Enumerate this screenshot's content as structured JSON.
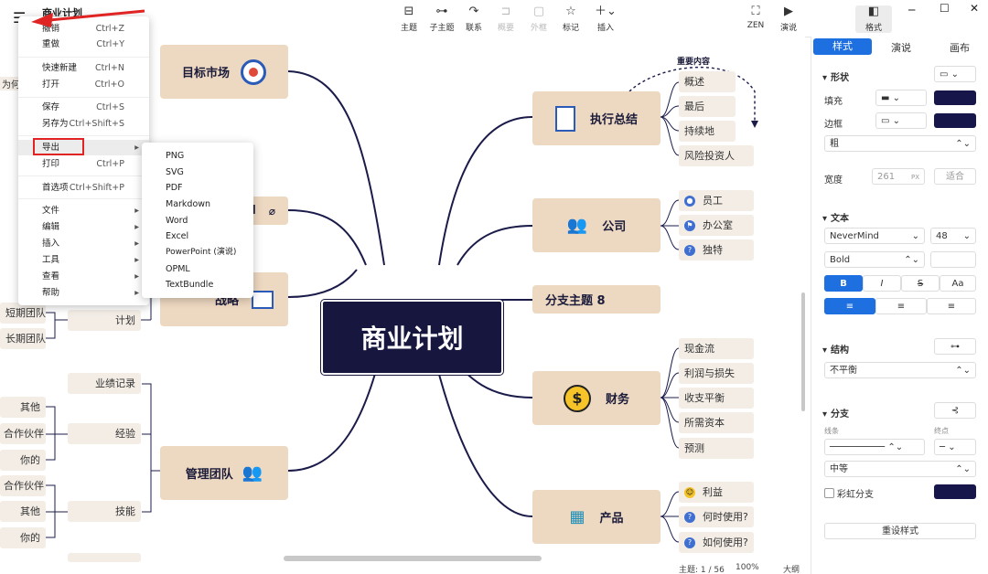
{
  "window": {
    "title": "商业计划"
  },
  "toolbar": {
    "items": [
      {
        "label": "主题",
        "icon": "topic-icon"
      },
      {
        "label": "子主题",
        "icon": "subtopic-icon"
      },
      {
        "label": "联系",
        "icon": "relationship-icon"
      },
      {
        "label": "概要",
        "icon": "summary-icon"
      },
      {
        "label": "外框",
        "icon": "boundary-icon"
      },
      {
        "label": "标记",
        "icon": "marker-icon"
      },
      {
        "label": "插入",
        "icon": "insert-icon"
      },
      {
        "label": "ZEN",
        "icon": "zen-icon"
      },
      {
        "label": "演说",
        "icon": "pitch-icon"
      },
      {
        "label": "格式",
        "icon": "format-icon"
      }
    ]
  },
  "mindmap": {
    "root": "商业计划",
    "left_nodes": {
      "target_market": "目标市场",
      "strategy": "战略",
      "management": "管理团队",
      "hidden_node_tail": "d"
    },
    "left_leaves": {
      "plan": "计划",
      "short_team": "短期团队",
      "long_team": "长期团队",
      "track_record": "业绩记录",
      "experience": "经验",
      "skills": "技能",
      "other1": "其他",
      "partner1": "合作伙伴",
      "yours1": "你的",
      "partner2": "合作伙伴",
      "other2": "其他",
      "yours2": "你的",
      "cut_text": "为何"
    },
    "right_nodes": {
      "exec_summary": "执行总结",
      "company": "公司",
      "branch8": "分支主题 8",
      "finance": "财务",
      "product": "产品"
    },
    "right_leaves": {
      "overview": "概述",
      "last": "最后",
      "sustain": "持续地",
      "vc": "风险投资人",
      "staff": "员工",
      "office": "办公室",
      "unique": "独特",
      "cashflow": "现金流",
      "profitloss": "利润与损失",
      "breakeven": "收支平衡",
      "capital": "所需资本",
      "forecast": "预测",
      "benefit": "利益",
      "when": "何时使用?",
      "how": "如何使用?"
    },
    "callout": "重要内容"
  },
  "menu": {
    "items": [
      {
        "label": "撤销",
        "shortcut": "Ctrl+Z"
      },
      {
        "label": "重做",
        "shortcut": "Ctrl+Y"
      },
      {
        "label": "快速新建",
        "shortcut": "Ctrl+N"
      },
      {
        "label": "打开",
        "shortcut": "Ctrl+O"
      },
      {
        "label": "保存",
        "shortcut": "Ctrl+S"
      },
      {
        "label": "另存为",
        "shortcut": "Ctrl+Shift+S"
      },
      {
        "label": "导出",
        "shortcut": ""
      },
      {
        "label": "打印",
        "shortcut": "Ctrl+P"
      },
      {
        "label": "首选项",
        "shortcut": "Ctrl+Shift+P"
      },
      {
        "label": "文件",
        "shortcut": ""
      },
      {
        "label": "编辑",
        "shortcut": ""
      },
      {
        "label": "插入",
        "shortcut": ""
      },
      {
        "label": "工具",
        "shortcut": ""
      },
      {
        "label": "查看",
        "shortcut": ""
      },
      {
        "label": "帮助",
        "shortcut": ""
      }
    ],
    "export_submenu": [
      "PNG",
      "SVG",
      "PDF",
      "Markdown",
      "Word",
      "Excel",
      "PowerPoint (演说)",
      "OPML",
      "TextBundle"
    ]
  },
  "panel": {
    "tabs": [
      "样式",
      "演说",
      "画布"
    ],
    "shape_section": "形状",
    "fill_label": "填充",
    "border_label": "边框",
    "border_weight": "粗",
    "width_label": "宽度",
    "width_value": "261",
    "width_unit": "PX",
    "width_fit": "适合",
    "text_section": "文本",
    "font_family": "NeverMind",
    "font_size": "48",
    "font_weight": "Bold",
    "bold_btn": "B",
    "italic_btn": "I",
    "strike_btn": "S",
    "case_btn": "Aa",
    "structure_section": "结构",
    "structure_value": "不平衡",
    "branch_section": "分支",
    "line_label": "线条",
    "endpoint_label": "终点",
    "branch_width": "中等",
    "rainbow_label": "彩虹分支",
    "reset_btn": "重设样式",
    "accent_color": "#16164a",
    "active_tab_color": "#1e6fe0"
  },
  "status": {
    "topics": "主题: 1 / 56",
    "zoom": "100%",
    "outline": "大纲"
  }
}
